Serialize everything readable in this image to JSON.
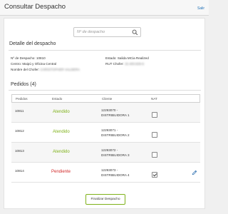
{
  "header": {
    "title": "Consultar Despacho",
    "logout_label": "Salir"
  },
  "search": {
    "placeholder": "Nº de despacho"
  },
  "detail": {
    "title": "Detalle del despacho",
    "despacho_label": "Nº de Despacho:",
    "despacho_value": "10810",
    "estado_label": "Estado:",
    "estado_value": "Salida MCia Realized",
    "centro_label": "Centro:",
    "centro_value": "Maipú y Oficina Central",
    "rut_label": "RUT Chofer:",
    "rut_value": "15.400.829-6",
    "nombre_label": "Nombre del Chofer:",
    "nombre_value": "CHRISTOPHER VALDERA"
  },
  "pedidos": {
    "title": "Pedidos (4)",
    "columns": [
      "Pedidos",
      "Estado",
      "Cliente",
      "NAT"
    ],
    "rows": [
      {
        "pedido": "10811",
        "estado": "Atendido",
        "cliente_code": "12293070 -",
        "cliente_name": "DISTRIBUIDORA 1",
        "nat_checked": false
      },
      {
        "pedido": "10812",
        "estado": "Atendido",
        "cliente_code": "12293071 -",
        "cliente_name": "DISTRIBUIDORA 2",
        "nat_checked": false
      },
      {
        "pedido": "10813",
        "estado": "Atendido",
        "cliente_code": "12293072 -",
        "cliente_name": "DISTRIBUIDORA 3",
        "nat_checked": false
      },
      {
        "pedido": "10814",
        "estado": "Pendiente",
        "cliente_code": "12293073 -",
        "cliente_name": "DISTRIBUIDORA 4",
        "nat_checked": true
      }
    ]
  },
  "actions": {
    "finalize_label": "Finalizar Despacho"
  },
  "colors": {
    "ok": "#7fb21a",
    "pending": "#d22b2b",
    "link": "#1f6fb5"
  },
  "icons": {
    "search": "magnifier-icon",
    "edit": "pencil-icon"
  }
}
